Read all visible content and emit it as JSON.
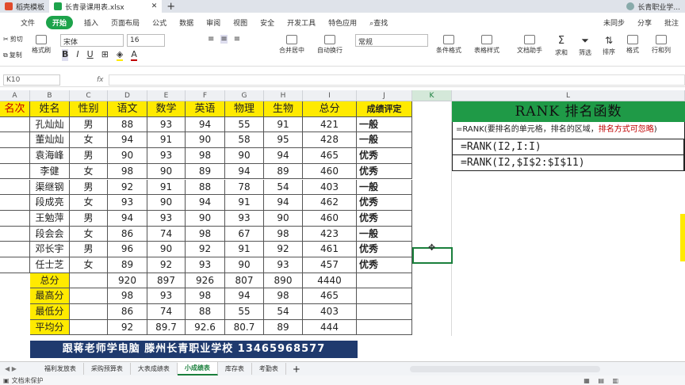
{
  "window": {
    "tab1": "稻壳模板",
    "tab2": "长青录课用表.xlsx",
    "user": "长青职业学..."
  },
  "menu": {
    "file": "文件",
    "start": "开始",
    "items": [
      "插入",
      "页面布局",
      "公式",
      "数据",
      "审阅",
      "视图",
      "安全",
      "开发工具",
      "特色应用"
    ],
    "search": "查找",
    "unsynced": "未同步",
    "share": "分享",
    "batch": "批注"
  },
  "ribbon": {
    "cut": "剪切",
    "copy": "复制",
    "format_painter": "格式刷",
    "font_name": "宋体",
    "font_size": "16",
    "merge": "合并居中",
    "wrap": "自动换行",
    "number_format": "常规",
    "cond_format": "条件格式",
    "table_style": "表格样式",
    "doc_helper": "文档助手",
    "sum": "求和",
    "filter": "筛选",
    "sort": "排序",
    "format": "格式",
    "rowcol": "行和列"
  },
  "formula_bar": {
    "cell_ref": "K10",
    "fx": "fx"
  },
  "columns": [
    "A",
    "B",
    "C",
    "D",
    "E",
    "F",
    "G",
    "H",
    "I",
    "J",
    "K",
    "L"
  ],
  "table": {
    "headers": [
      "名次",
      "姓名",
      "性别",
      "语文",
      "数学",
      "英语",
      "物理",
      "生物",
      "总分",
      "成绩评定"
    ],
    "rows": [
      [
        "孔灿灿",
        "男",
        "88",
        "93",
        "94",
        "55",
        "91",
        "421",
        "一般"
      ],
      [
        "董灿灿",
        "女",
        "94",
        "91",
        "90",
        "58",
        "95",
        "428",
        "一般"
      ],
      [
        "袁海峰",
        "男",
        "90",
        "93",
        "98",
        "90",
        "94",
        "465",
        "优秀"
      ],
      [
        "李健",
        "女",
        "98",
        "90",
        "89",
        "94",
        "89",
        "460",
        "优秀"
      ],
      [
        "渠继钢",
        "男",
        "92",
        "91",
        "88",
        "78",
        "54",
        "403",
        "一般"
      ],
      [
        "段成亮",
        "女",
        "93",
        "90",
        "94",
        "91",
        "94",
        "462",
        "优秀"
      ],
      [
        "王勉萍",
        "男",
        "94",
        "93",
        "90",
        "93",
        "90",
        "460",
        "优秀"
      ],
      [
        "段会会",
        "女",
        "86",
        "74",
        "98",
        "67",
        "98",
        "423",
        "一般"
      ],
      [
        "邓长宇",
        "男",
        "96",
        "90",
        "92",
        "91",
        "92",
        "461",
        "优秀"
      ],
      [
        "任士芝",
        "女",
        "89",
        "92",
        "93",
        "90",
        "93",
        "457",
        "优秀"
      ]
    ],
    "summary": [
      {
        "label": "总分",
        "values": [
          "920",
          "897",
          "926",
          "807",
          "890",
          "4440"
        ]
      },
      {
        "label": "最高分",
        "values": [
          "98",
          "93",
          "98",
          "94",
          "98",
          "465"
        ]
      },
      {
        "label": "最低分",
        "values": [
          "86",
          "74",
          "88",
          "55",
          "54",
          "403"
        ]
      },
      {
        "label": "平均分",
        "values": [
          "92",
          "89.7",
          "92.6",
          "80.7",
          "89",
          "444"
        ]
      }
    ]
  },
  "rank_panel": {
    "title": "RANK 排名函数",
    "desc_main": "=RANK(要排名的单元格，排名的区域，",
    "desc_red": "排名方式可忽略",
    "desc_end": ")",
    "formula1": "=RANK(I2,I:I)",
    "formula2": "=RANK(I2,$I$2:$I$11)"
  },
  "banner": "跟蒋老师学电脑  滕州长青职业学校  13465968577",
  "sheets": [
    "福利发放表",
    "采购预算表",
    "大表成绩表",
    "小成绩表",
    "库存表",
    "考勤表"
  ],
  "active_sheet": "小成绩表",
  "status": "文档未保护",
  "colors": {
    "header_yellow": "#ffea00",
    "panel_green": "#1f9a47",
    "accent_red": "#c00000",
    "banner_blue": "#1f3a6e"
  }
}
